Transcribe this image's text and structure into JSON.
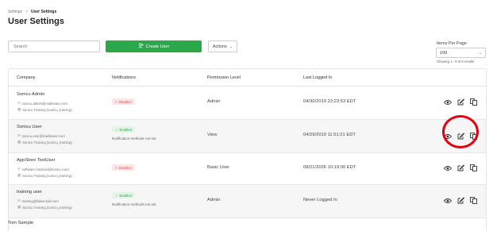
{
  "breadcrumb": {
    "parent": "Settings",
    "separator": ">",
    "current": "User Settings"
  },
  "page_title": "User Settings",
  "toolbar": {
    "search_placeholder": "Search",
    "create_label": "Create User",
    "create_icon": "add-user-icon",
    "actions_label": "Actions",
    "actions_chevron": "⌄"
  },
  "pagination": {
    "items_per_page_label": "Items Per Page",
    "items_per_page_value": "100",
    "chevron": "⌄",
    "showing": "Showing 1 - 9 of 9 results"
  },
  "table": {
    "headers": {
      "company": "Company",
      "notifications": "Notifications",
      "permission": "Permission Level",
      "last_logged": "Last Logged In"
    },
    "rows": [
      {
        "name": "Sonicu Admin",
        "email": "sonicu.admin@mailinator.com",
        "org": "Sonicu Training (sonicu_training)",
        "badge": "Disabled",
        "badge_icon": "×",
        "note": "",
        "permission": "Admin",
        "last_logged": "04/30/2019 22:23:53 EDT"
      },
      {
        "name": "Sonicu User",
        "email": "sonicu.user@mailinator.com",
        "org": "Sonicu Training (sonicu_training)",
        "badge": "Enabled",
        "badge_icon": "✓",
        "note": "Notification methods not set",
        "permission": "View",
        "last_logged": "04/29/2019 11:51:21 EDT"
      },
      {
        "name": "AppStore TestUser",
        "email": "software+android@sonicu.com",
        "org": "Sonicu Training (sonicu_training)",
        "badge": "Disabled",
        "badge_icon": "×",
        "note": "",
        "permission": "Basic User",
        "last_logged": "08/21/2026 10:19:00 EDT"
      },
      {
        "name": "training user",
        "email": "training@fakeemail.com",
        "org": "Sonicu Training (sonicu_training)",
        "badge": "Enabled",
        "badge_icon": "✓",
        "note": "Notification methods not set",
        "permission": "Admin",
        "last_logged": "Never Logged In"
      }
    ],
    "partial_row_name": "Tom Sample"
  },
  "colors": {
    "create_button": "#2aa84a",
    "disabled_badge": "#d9534f",
    "enabled_badge": "#2aa84a",
    "highlight": "#e0000f"
  },
  "icons": {
    "email": "mail-icon",
    "org": "building-icon",
    "view": "eye-icon",
    "edit": "edit-icon",
    "copy": "copy-icon"
  }
}
